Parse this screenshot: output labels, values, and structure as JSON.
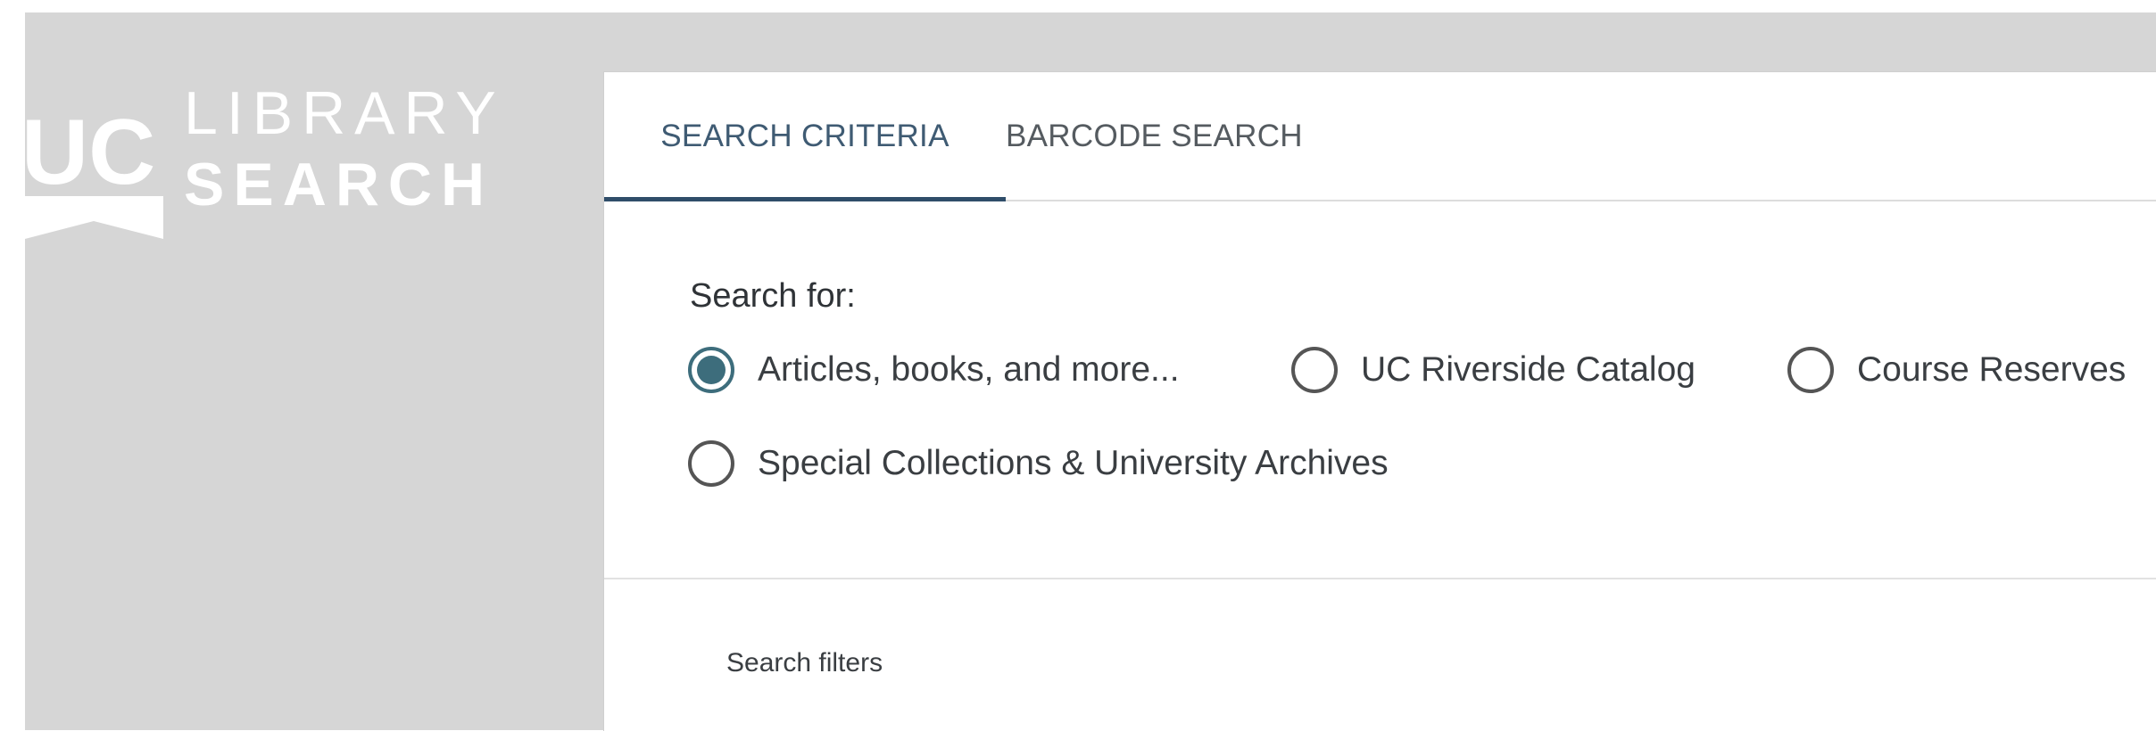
{
  "logo": {
    "mark": "UC",
    "line1": "LIBRARY",
    "line2": "SEARCH"
  },
  "tabs": [
    {
      "label": "SEARCH CRITERIA",
      "active": true
    },
    {
      "label": "BARCODE SEARCH",
      "active": false
    }
  ],
  "search_for": {
    "label": "Search for:",
    "options": [
      {
        "label": "Articles, books, and more...",
        "checked": true
      },
      {
        "label": "UC Riverside Catalog",
        "checked": false
      },
      {
        "label": "Course Reserves",
        "checked": false
      },
      {
        "label": "Special Collections & University Archives",
        "checked": false
      }
    ]
  },
  "filters": {
    "label": "Search filters"
  },
  "colors": {
    "background": "#d6d6d6",
    "panel": "#ffffff",
    "accent": "#2f4d69",
    "radio_checked": "#3d6d7c"
  }
}
